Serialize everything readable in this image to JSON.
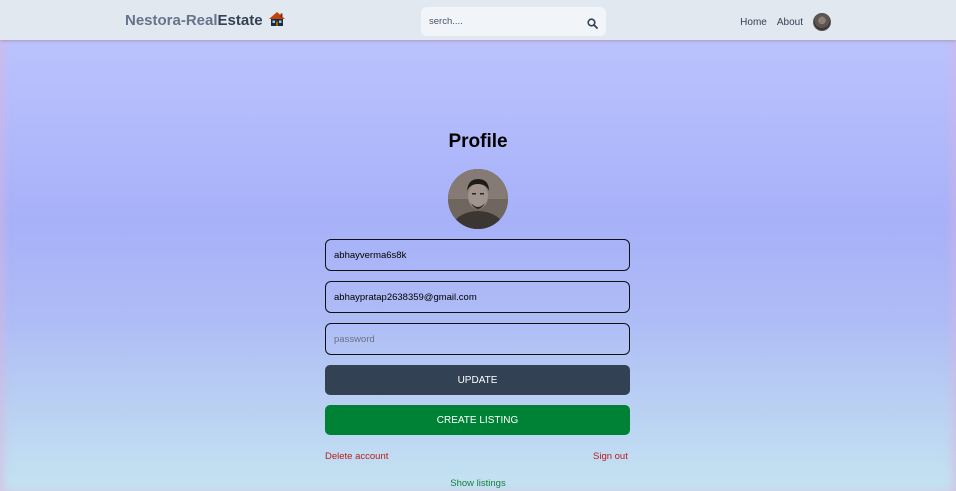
{
  "header": {
    "logo_part1": "Nestora-Real",
    "logo_part2": "Estate",
    "search_placeholder": "serch....",
    "nav": {
      "home": "Home",
      "about": "About"
    }
  },
  "profile": {
    "title": "Profile",
    "username": "abhayverma6s8k",
    "email": "abhaypratap2638359@gmail.com",
    "password_placeholder": "password",
    "update_label": "UPDATE",
    "create_listing_label": "CREATE LISTING",
    "delete_label": "Delete account",
    "signout_label": "Sign out",
    "show_listings_label": "Show listings"
  },
  "colors": {
    "header_bg": "#e2e8f0",
    "update_button": "#334155",
    "create_button": "#008236",
    "danger": "#b91c1c",
    "success": "#15803d"
  }
}
